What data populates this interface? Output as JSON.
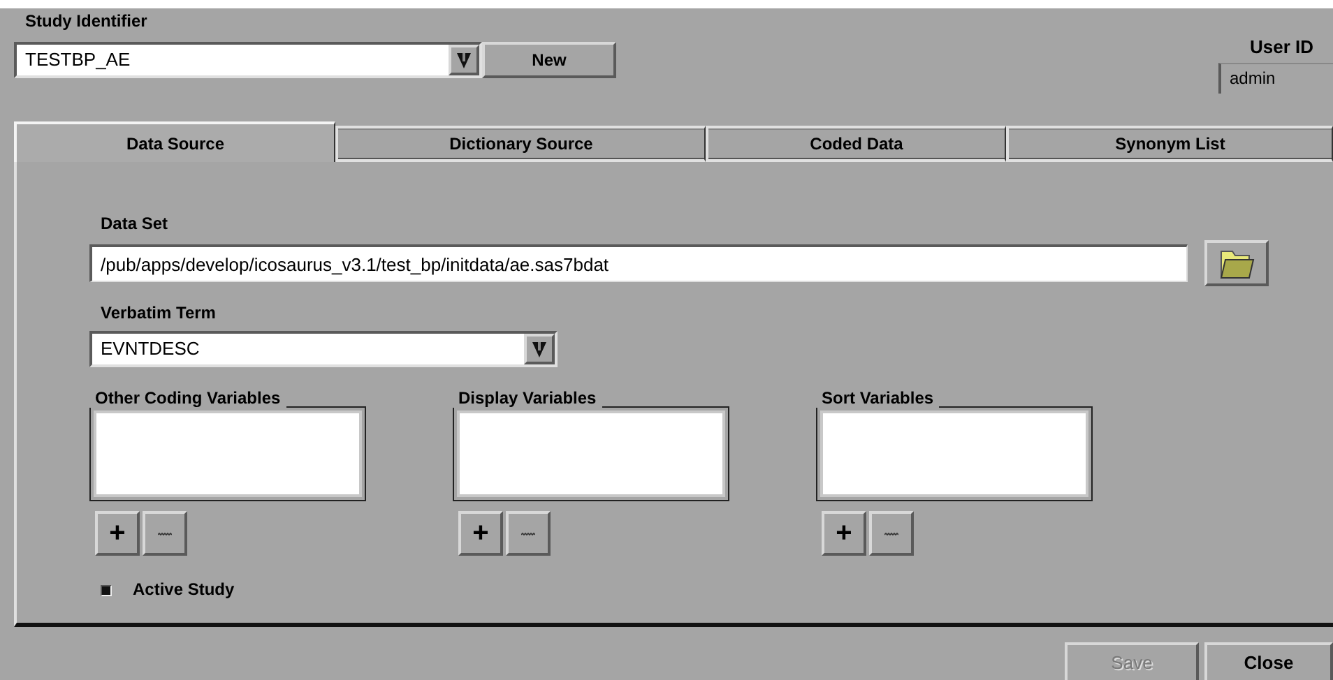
{
  "study_identifier": {
    "label": "Study Identifier",
    "value": "TESTBP_AE"
  },
  "new_button": {
    "label": "New"
  },
  "user_id": {
    "label": "User ID",
    "value": "admin"
  },
  "tabs": [
    {
      "label": "Data Source",
      "selected": true
    },
    {
      "label": "Dictionary Source",
      "selected": false
    },
    {
      "label": "Coded Data",
      "selected": false
    },
    {
      "label": "Synonym List",
      "selected": false
    }
  ],
  "data_set": {
    "label": "Data Set",
    "value": "/pub/apps/develop/icosaurus_v3.1/test_bp/initdata/ae.sas7bdat"
  },
  "verbatim_term": {
    "label": "Verbatim Term",
    "value": "EVNTDESC"
  },
  "variable_lists": [
    {
      "label": "Other Coding Variables",
      "add": "+"
    },
    {
      "label": "Display Variables",
      "add": "+"
    },
    {
      "label": "Sort Variables",
      "add": "+"
    }
  ],
  "active_study": {
    "label": "Active Study",
    "checked": true
  },
  "buttons": [
    {
      "label": "Save",
      "disabled": true
    },
    {
      "label": "Close",
      "disabled": false
    }
  ]
}
